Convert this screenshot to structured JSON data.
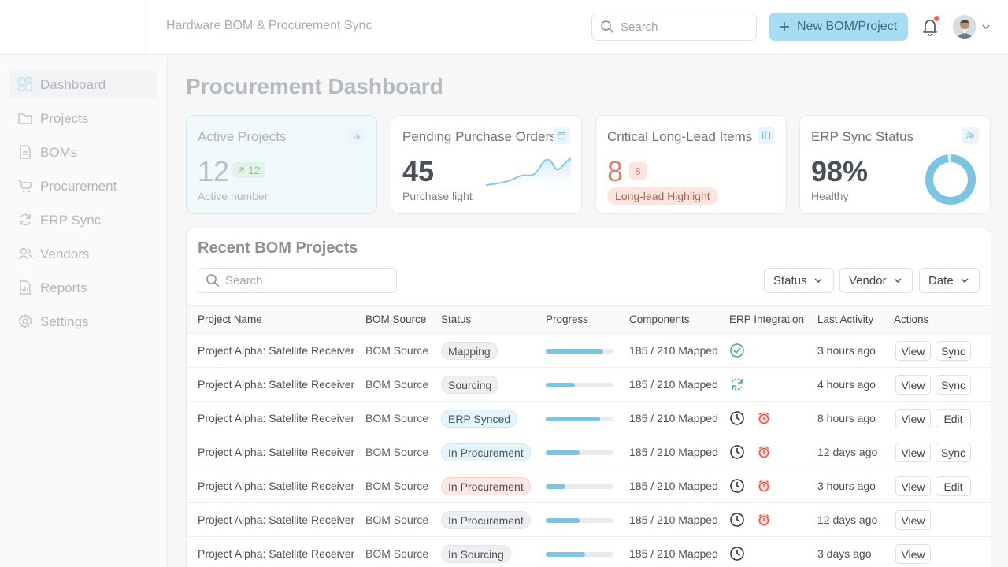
{
  "header": {
    "app_title": "Hardware BOM & Procurement Sync",
    "search_placeholder": "Search",
    "new_button": "New BOM/Project"
  },
  "sidebar": {
    "items": [
      {
        "label": "Dashboard",
        "icon": "grid-icon",
        "active": true
      },
      {
        "label": "Projects",
        "icon": "folder-icon"
      },
      {
        "label": "BOMs",
        "icon": "document-icon"
      },
      {
        "label": "Procurement",
        "icon": "cart-icon"
      },
      {
        "label": "ERP Sync",
        "icon": "sync-icon"
      },
      {
        "label": "Vendors",
        "icon": "users-icon"
      },
      {
        "label": "Reports",
        "icon": "report-icon"
      },
      {
        "label": "Settings",
        "icon": "gear-icon"
      }
    ]
  },
  "page": {
    "title": "Procurement Dashboard"
  },
  "cards": {
    "active_projects": {
      "title": "Active Projects",
      "value": "12",
      "delta": "12",
      "sub": "Active number"
    },
    "pending_pos": {
      "title": "Pending Purchase Orders",
      "value": "45",
      "sub": "Purchase light"
    },
    "critical_items": {
      "title": "Critical Long-Lead Items",
      "value": "8",
      "badge": "8",
      "tag": "Long-lead Highlight"
    },
    "erp_status": {
      "title": "ERP Sync Status",
      "value": "98%",
      "sub": "Healthy",
      "ring_fraction": 0.98
    }
  },
  "recent": {
    "title": "Recent BOM Projects",
    "search_placeholder": "Search",
    "filters": {
      "status": "Status",
      "vendor": "Vendor",
      "date": "Date"
    },
    "columns": {
      "project": "Project Name",
      "source": "BOM Source",
      "status": "Status",
      "progress": "Progress",
      "components": "Components",
      "erp": "ERP Integration",
      "activity": "Last Activity",
      "actions": "Actions"
    },
    "rows": [
      {
        "project": "Project Alpha: Satellite Receiver",
        "source": "BOM Source",
        "status": "Mapping",
        "status_style": "gray",
        "progress": 0.85,
        "components": "185 / 210 Mapped",
        "erp": [
          "check-circle-icon"
        ],
        "activity": "3 hours ago",
        "actions": [
          "View",
          "Sync"
        ]
      },
      {
        "project": "Project Alpha: Satellite Receiver",
        "source": "BOM Source",
        "status": "Sourcing",
        "status_style": "gray",
        "progress": 0.43,
        "components": "185 / 210 Mapped",
        "erp": [
          "sync-status-icon"
        ],
        "activity": "4 hours ago",
        "actions": [
          "View",
          "Sync"
        ]
      },
      {
        "project": "Project Alpha: Satellite Receiver",
        "source": "BOM Source",
        "status": "ERP Synced",
        "status_style": "blue",
        "progress": 0.8,
        "components": "185 / 210 Mapped",
        "erp": [
          "clock-icon",
          "alarm-icon"
        ],
        "activity": "8 hours ago",
        "actions": [
          "View",
          "Edit"
        ]
      },
      {
        "project": "Project Alpha: Satellite Receiver",
        "source": "BOM Source",
        "status": "In Procurement",
        "status_style": "blue",
        "progress": 0.5,
        "components": "185 / 210 Mapped",
        "erp": [
          "clock-icon",
          "alarm-icon"
        ],
        "activity": "12 days ago",
        "actions": [
          "View",
          "Sync"
        ]
      },
      {
        "project": "Project Alpha: Satellite Receiver",
        "source": "BOM Source",
        "status": "In Procurement",
        "status_style": "orange",
        "progress": 0.29,
        "components": "185 / 210 Mapped",
        "erp": [
          "clock-icon",
          "alarm-icon"
        ],
        "activity": "3 hours ago",
        "actions": [
          "View",
          "Edit"
        ]
      },
      {
        "project": "Project Alpha: Satellite Receiver",
        "source": "BOM Source",
        "status": "In Procurement",
        "status_style": "gray",
        "progress": 0.5,
        "components": "185 / 210 Mapped",
        "erp": [
          "clock-icon",
          "alarm-icon"
        ],
        "activity": "12 days ago",
        "actions": [
          "View"
        ]
      },
      {
        "project": "Project Alpha: Satellite Receiver",
        "source": "BOM Source",
        "status": "In Sourcing",
        "status_style": "gray",
        "progress": 0.58,
        "components": "185 / 210 Mapped",
        "erp": [
          "clock-icon"
        ],
        "activity": "3 days ago",
        "actions": [
          "View"
        ]
      }
    ]
  }
}
